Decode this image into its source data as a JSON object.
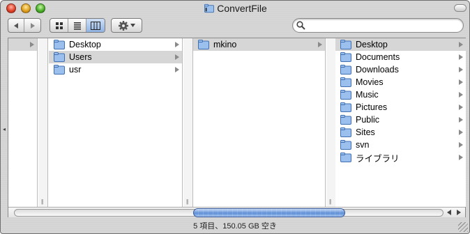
{
  "window": {
    "title": "ConvertFile"
  },
  "toolbar": {
    "search_placeholder": "",
    "view_modes": [
      "icon",
      "list",
      "column"
    ],
    "active_view": "column"
  },
  "columns": [
    {
      "items": [
        {
          "label": "",
          "selected": true,
          "has_children": true
        }
      ]
    },
    {
      "items": [
        {
          "label": "Desktop",
          "selected": false,
          "has_children": true
        },
        {
          "label": "Users",
          "selected": true,
          "has_children": true
        },
        {
          "label": "usr",
          "selected": false,
          "has_children": true
        }
      ]
    },
    {
      "items": [
        {
          "label": "mkino",
          "selected": true,
          "has_children": true
        }
      ]
    },
    {
      "items": [
        {
          "label": "Desktop",
          "selected": true,
          "has_children": true
        },
        {
          "label": "Documents",
          "selected": false,
          "has_children": true
        },
        {
          "label": "Downloads",
          "selected": false,
          "has_children": true
        },
        {
          "label": "Movies",
          "selected": false,
          "has_children": true
        },
        {
          "label": "Music",
          "selected": false,
          "has_children": true
        },
        {
          "label": "Pictures",
          "selected": false,
          "has_children": true
        },
        {
          "label": "Public",
          "selected": false,
          "has_children": true
        },
        {
          "label": "Sites",
          "selected": false,
          "has_children": true
        },
        {
          "label": "svn",
          "selected": false,
          "has_children": true
        },
        {
          "label": "ライブラリ",
          "selected": false,
          "has_children": true
        }
      ]
    }
  ],
  "status": {
    "text": "5 項目、150.05 GB 空き"
  },
  "colors": {
    "selection": "#d6d6d6",
    "scroll_thumb": "#5e8fd6",
    "folder": "#6f9fdc"
  }
}
